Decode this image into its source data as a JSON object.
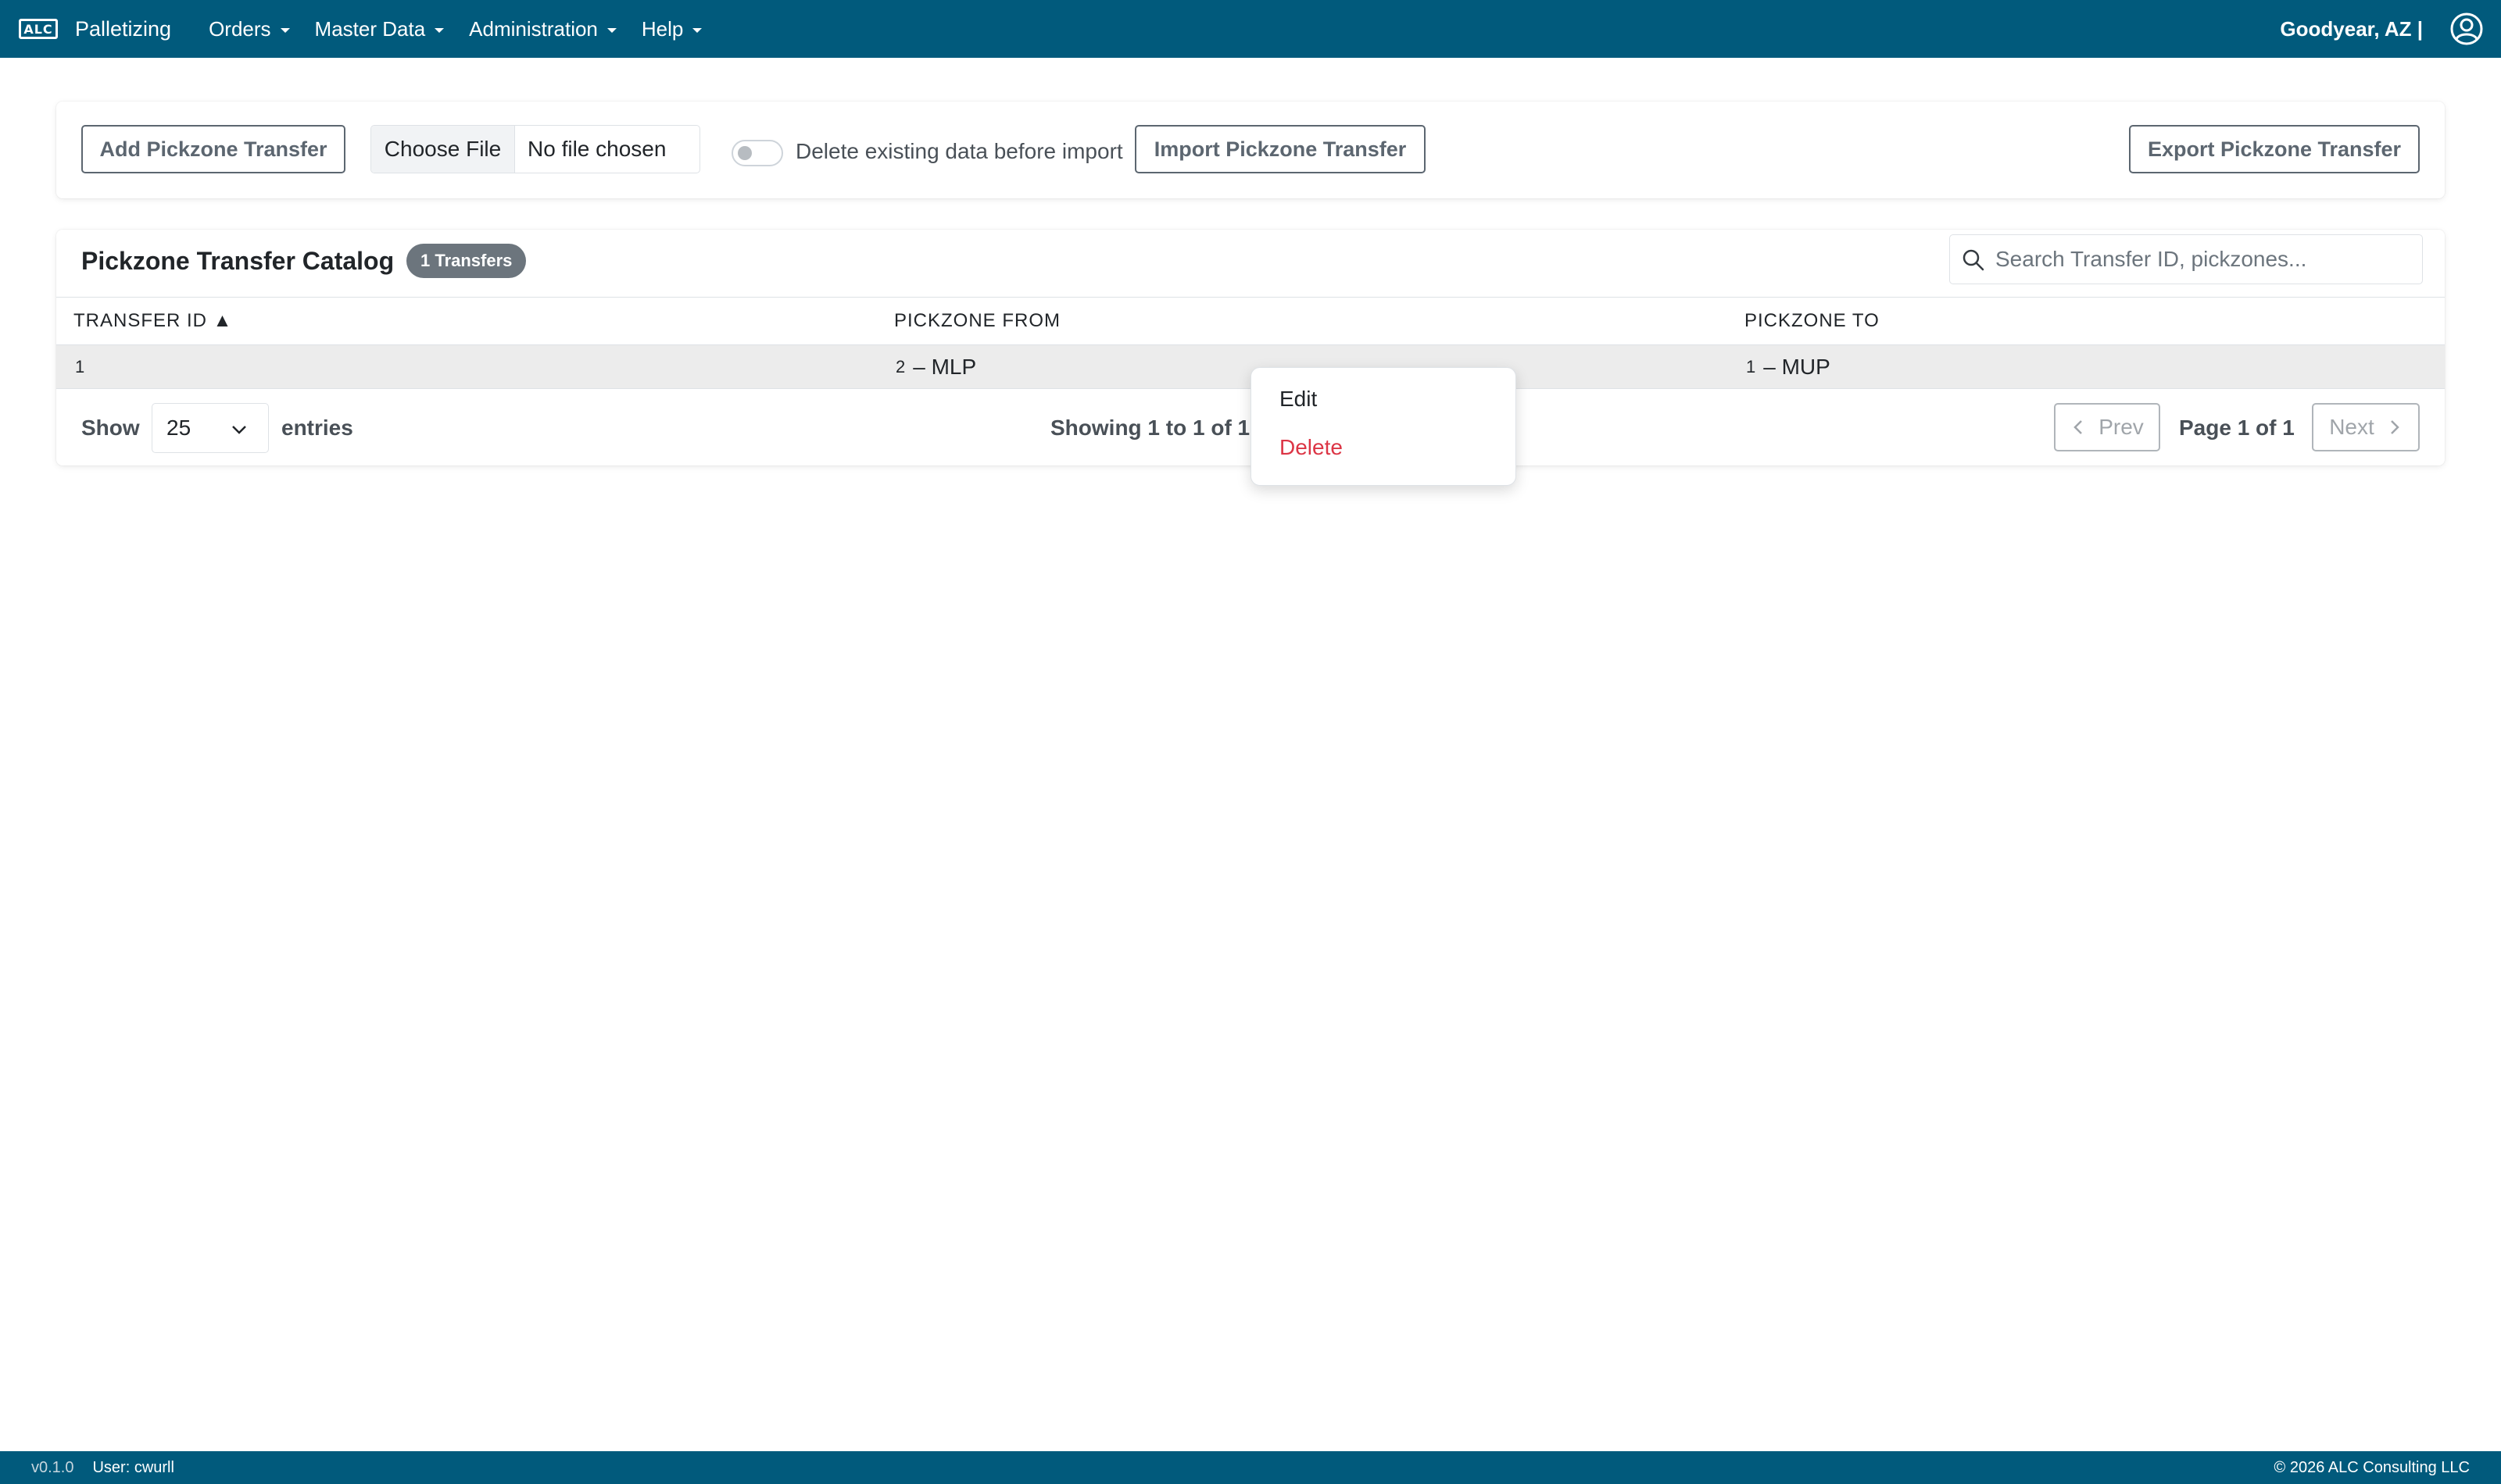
{
  "navbar": {
    "logo_text": "ALC",
    "app_name": "Palletizing",
    "menu": [
      {
        "label": "Orders"
      },
      {
        "label": "Master Data"
      },
      {
        "label": "Administration"
      },
      {
        "label": "Help"
      }
    ],
    "location": "Goodyear, AZ |",
    "user_icon": "user-circle-icon"
  },
  "import_bar": {
    "add_button": "Add Pickzone Transfer",
    "file_choose": "Choose File",
    "file_name": "No file chosen",
    "delete_toggle_label": "Delete existing data before import",
    "delete_toggle_on": false,
    "import_button": "Import Pickzone Transfer",
    "export_button": "Export Pickzone Transfer"
  },
  "catalog": {
    "title": "Pickzone Transfer Catalog",
    "badge": "1 Transfers",
    "search_placeholder": "Search Transfer ID, pickzones...",
    "columns": [
      "TRANSFER ID ▲",
      "PICKZONE FROM",
      "PICKZONE TO"
    ],
    "rows": [
      {
        "transfer_id": "1",
        "from_num": "2",
        "from_name": "– MLP",
        "to_num": "1",
        "to_name": "– MUP"
      }
    ],
    "footer": {
      "show_label": "Show",
      "page_size": "25",
      "entries_label": "entries",
      "showing": "Showing 1 to 1 of 1",
      "prev": "Prev",
      "page": "Page 1 of 1",
      "next": "Next"
    }
  },
  "context_menu": {
    "edit": "Edit",
    "delete": "Delete"
  },
  "footer": {
    "version": "v0.1.0",
    "user": "User: cwurll",
    "copyright": "© 2026 ALC Consulting LLC"
  },
  "colors": {
    "navbar": "#015a7c",
    "delete": "#dc3545",
    "badge": "#6c757d"
  }
}
